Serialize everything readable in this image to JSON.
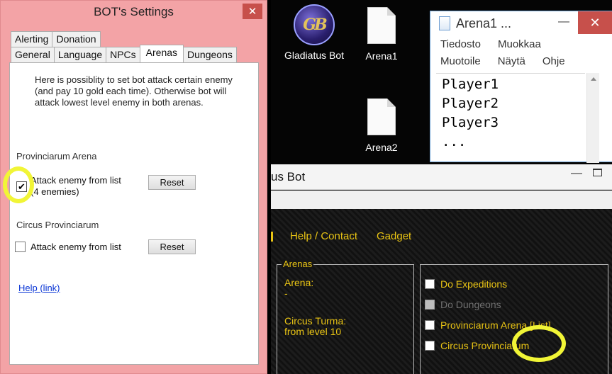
{
  "settings": {
    "title": "BOT's Settings",
    "close_glyph": "✕",
    "tabs_top": [
      "Alerting",
      "Donation"
    ],
    "tabs_bottom": [
      "General",
      "Language",
      "NPCs",
      "Arenas",
      "Dungeons"
    ],
    "active_tab": "Arenas",
    "description": "Here is possiblity to  set bot attack certain enemy (and pay 10 gold each time). Otherwise bot will attack lowest level enemy in both arenas.",
    "provinciarum": {
      "heading": "Provinciarum Arena",
      "checkbox_label_line1": "Attack enemy from list",
      "checkbox_label_line2": "(4 enemies)",
      "checked": true,
      "reset_label": "Reset"
    },
    "circus": {
      "heading": "Circus Provinciarum",
      "checkbox_label": "Attack enemy from list",
      "checked": false,
      "reset_label": "Reset"
    },
    "help_link": "Help (link)"
  },
  "desktop": {
    "icons": [
      {
        "label": "Gladiatus Bot",
        "logo_text": "GB"
      },
      {
        "label": "Arena1"
      },
      {
        "label": "Arena2"
      }
    ]
  },
  "notepad": {
    "title": "Arena1 ...",
    "minimize_glyph": "—",
    "close_glyph": "✕",
    "menu": [
      "Tiedosto",
      "Muokkaa",
      "Muotoile",
      "Näytä",
      "Ohje"
    ],
    "lines": [
      "Player1",
      "Player2",
      "Player3",
      "..."
    ]
  },
  "bot_window": {
    "title_partial": "us Bot",
    "minimize_glyph": "—",
    "nav": [
      "Help / Contact",
      "Gadget"
    ],
    "arenas_panel": {
      "legend": "Arenas",
      "arena_label": "Arena:",
      "arena_value": "-",
      "circus_label": "Circus Turma:",
      "circus_value": "from level 10"
    },
    "options": [
      {
        "label": "Do Expeditions",
        "enabled": true
      },
      {
        "label": "Do Dungeons",
        "enabled": false
      },
      {
        "label": "Provinciarum Arena [List]",
        "enabled": true
      },
      {
        "label": "Circus Provinciarum",
        "enabled": true
      }
    ]
  },
  "colors": {
    "highlight": "#f1f536",
    "bot_accent": "#e9c414",
    "dialog_frame": "#f3a3a6",
    "close_red": "#c7504b",
    "link_blue": "#0a36d6"
  }
}
